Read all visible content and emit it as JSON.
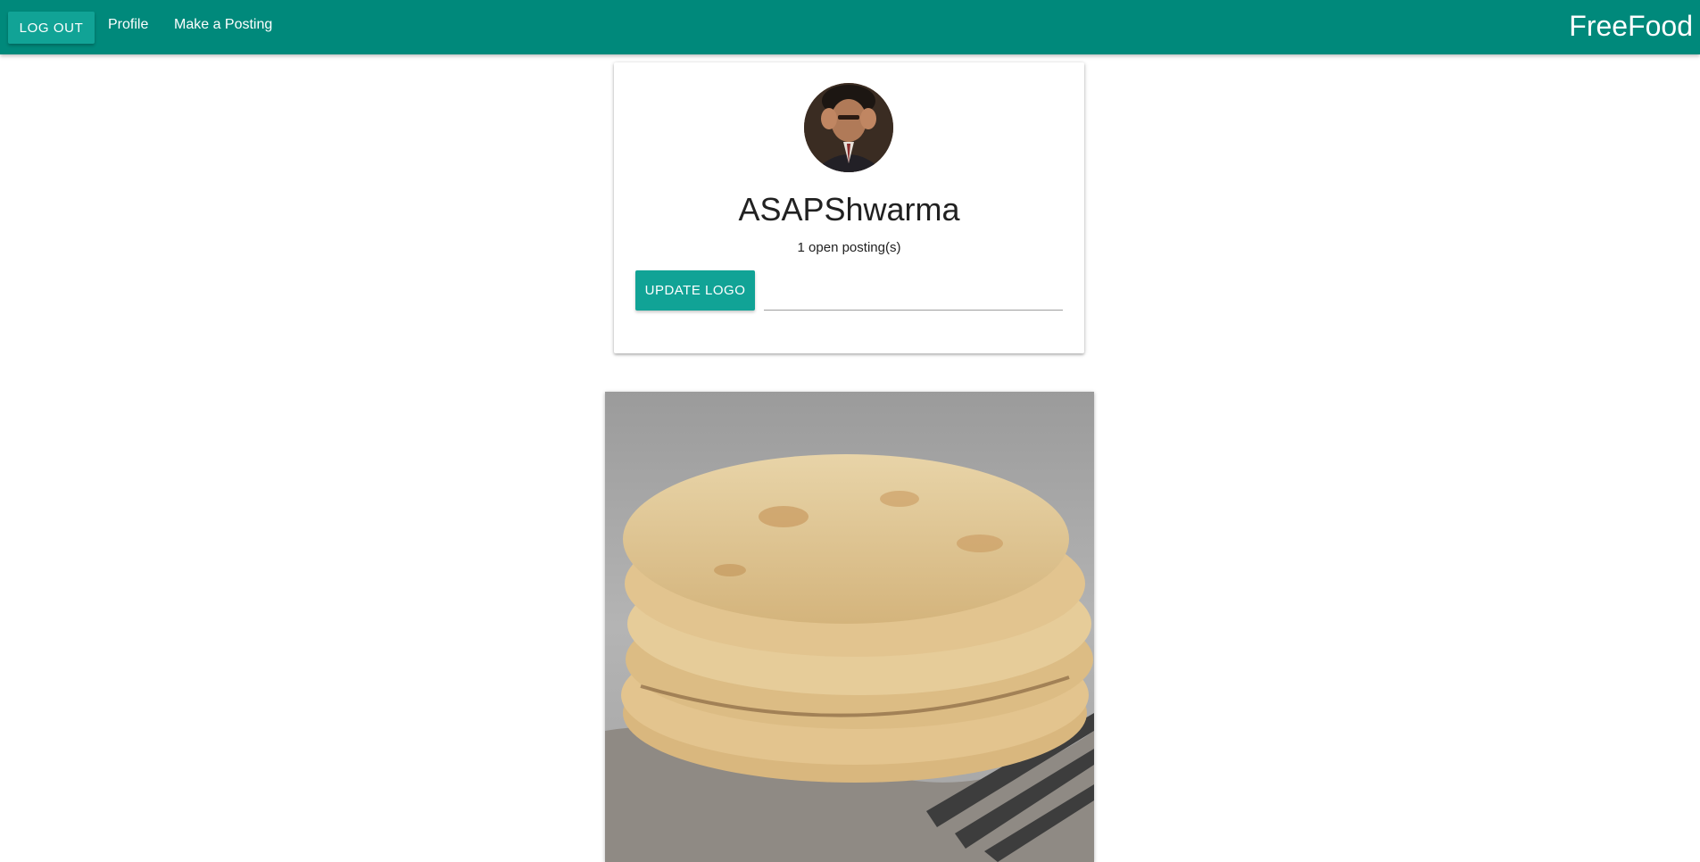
{
  "navbar": {
    "logout_label": "LOG OUT",
    "profile_label": "Profile",
    "posting_label": "Make a Posting",
    "brand": "FreeFood",
    "background_color": "#00897b",
    "button_color": "#11a396"
  },
  "profile": {
    "avatar_icon": "profile-photo",
    "username": "ASAPShwarma",
    "postings_text": "1 open posting(s)",
    "update_logo_label": "UPDATE LOGO",
    "logo_input_value": ""
  },
  "posting": {
    "image_icon": "flatbread-photo"
  }
}
